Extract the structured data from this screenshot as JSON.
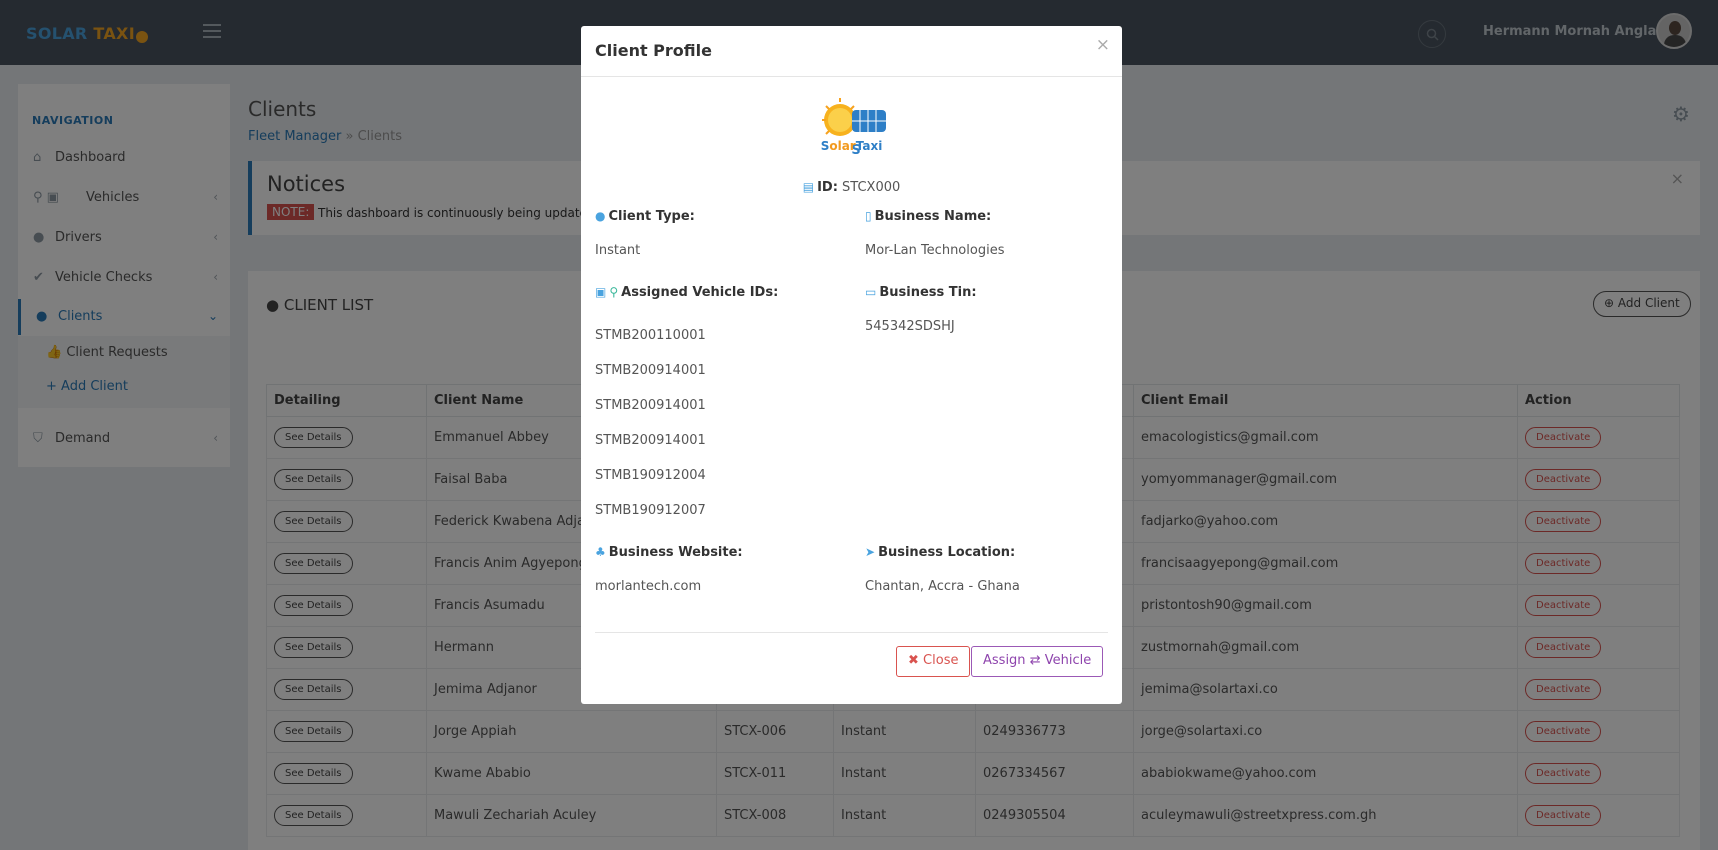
{
  "app": {
    "logo_primary": "SOLAR",
    "logo_secondary": "TAXI",
    "user_name": "Hermann Mornah Anglania"
  },
  "sidebar": {
    "heading": "NAVIGATION",
    "items": [
      {
        "label": "Dashboard",
        "icon": "home-icon"
      },
      {
        "label": "Vehicles",
        "icon": "vehicle-icon"
      },
      {
        "label": "Drivers",
        "icon": "user-icon"
      },
      {
        "label": "Vehicle Checks",
        "icon": "check-icon"
      },
      {
        "label": "Clients",
        "icon": "user-lock-icon"
      },
      {
        "label": "Demand",
        "icon": "shield-icon"
      }
    ],
    "submenu": [
      {
        "label": "Client Requests",
        "icon": "thumbs-up-icon"
      },
      {
        "label": "Add Client",
        "icon": "plus-icon"
      }
    ]
  },
  "page": {
    "title": "Clients",
    "breadcrumb": {
      "parent": "Fleet Manager",
      "current": "Clients"
    }
  },
  "notices": {
    "title": "Notices",
    "badge": "NOTE:",
    "text": "This dashboard is continuously being updated, h"
  },
  "client_list": {
    "header": "CLIENT LIST",
    "add_button": "Add Client",
    "columns": [
      "Detailing",
      "Client Name",
      "",
      "",
      "",
      "Client Email",
      "Action"
    ],
    "see_details_label": "See Details",
    "deactivate_label": "Deactivate",
    "rows": [
      {
        "name": "Emmanuel Abbey",
        "id": "",
        "type": "",
        "phone": "",
        "email": "emacologistics@gmail.com"
      },
      {
        "name": "Faisal Baba",
        "id": "",
        "type": "",
        "phone": "",
        "email": "yomyommanager@gmail.com"
      },
      {
        "name": "Federick Kwabena Adjar",
        "id": "",
        "type": "",
        "phone": "",
        "email": "fadjarko@yahoo.com"
      },
      {
        "name": "Francis Anim Agyepong",
        "id": "",
        "type": "",
        "phone": "",
        "email": "francisaagyepong@gmail.com"
      },
      {
        "name": "Francis Asumadu",
        "id": "",
        "type": "",
        "phone": "",
        "email": "pristontosh90@gmail.com"
      },
      {
        "name": "Hermann",
        "id": "",
        "type": "",
        "phone": "",
        "email": "zustmornah@gmail.com"
      },
      {
        "name": "Jemima Adjanor",
        "id": "",
        "type": "",
        "phone": "",
        "email": "jemima@solartaxi.co"
      },
      {
        "name": "Jorge Appiah",
        "id": "STCX-006",
        "type": "Instant",
        "phone": "0249336773",
        "email": "jorge@solartaxi.co"
      },
      {
        "name": "Kwame Ababio",
        "id": "STCX-011",
        "type": "Instant",
        "phone": "0267334567",
        "email": "ababiokwame@yahoo.com"
      },
      {
        "name": "Mawuli Zechariah Aculey",
        "id": "STCX-008",
        "type": "Instant",
        "phone": "0249305504",
        "email": "aculeymawuli@streetxpress.com.gh"
      }
    ]
  },
  "modal": {
    "title": "Client Profile",
    "logo_text": "SolarTaxi",
    "id_label": "ID:",
    "id_value": "STCX000",
    "client_type_label": "Client Type:",
    "client_type_value": "Instant",
    "business_name_label": "Business Name:",
    "business_name_value": "Mor-Lan Technologies",
    "vehicles_label": "Assigned Vehicle IDs:",
    "vehicle_ids": [
      "STMB200110001",
      "STMB200914001",
      "STMB200914001",
      "STMB200914001",
      "STMB190912004",
      "STMB190912007"
    ],
    "business_tin_label": "Business Tin:",
    "business_tin_value": "545342SDSHJ",
    "website_label": "Business Website:",
    "website_value": "morlantech.com",
    "location_label": "Business Location:",
    "location_value": "Chantan, Accra - Ghana",
    "close_label": "Close",
    "assign_label_pre": "Assign",
    "assign_label_post": "Vehicle"
  },
  "colors": {
    "topbar": "#4a5560",
    "accent": "#2a7ab8",
    "danger": "#d9534f",
    "assign": "#8e44ad"
  }
}
